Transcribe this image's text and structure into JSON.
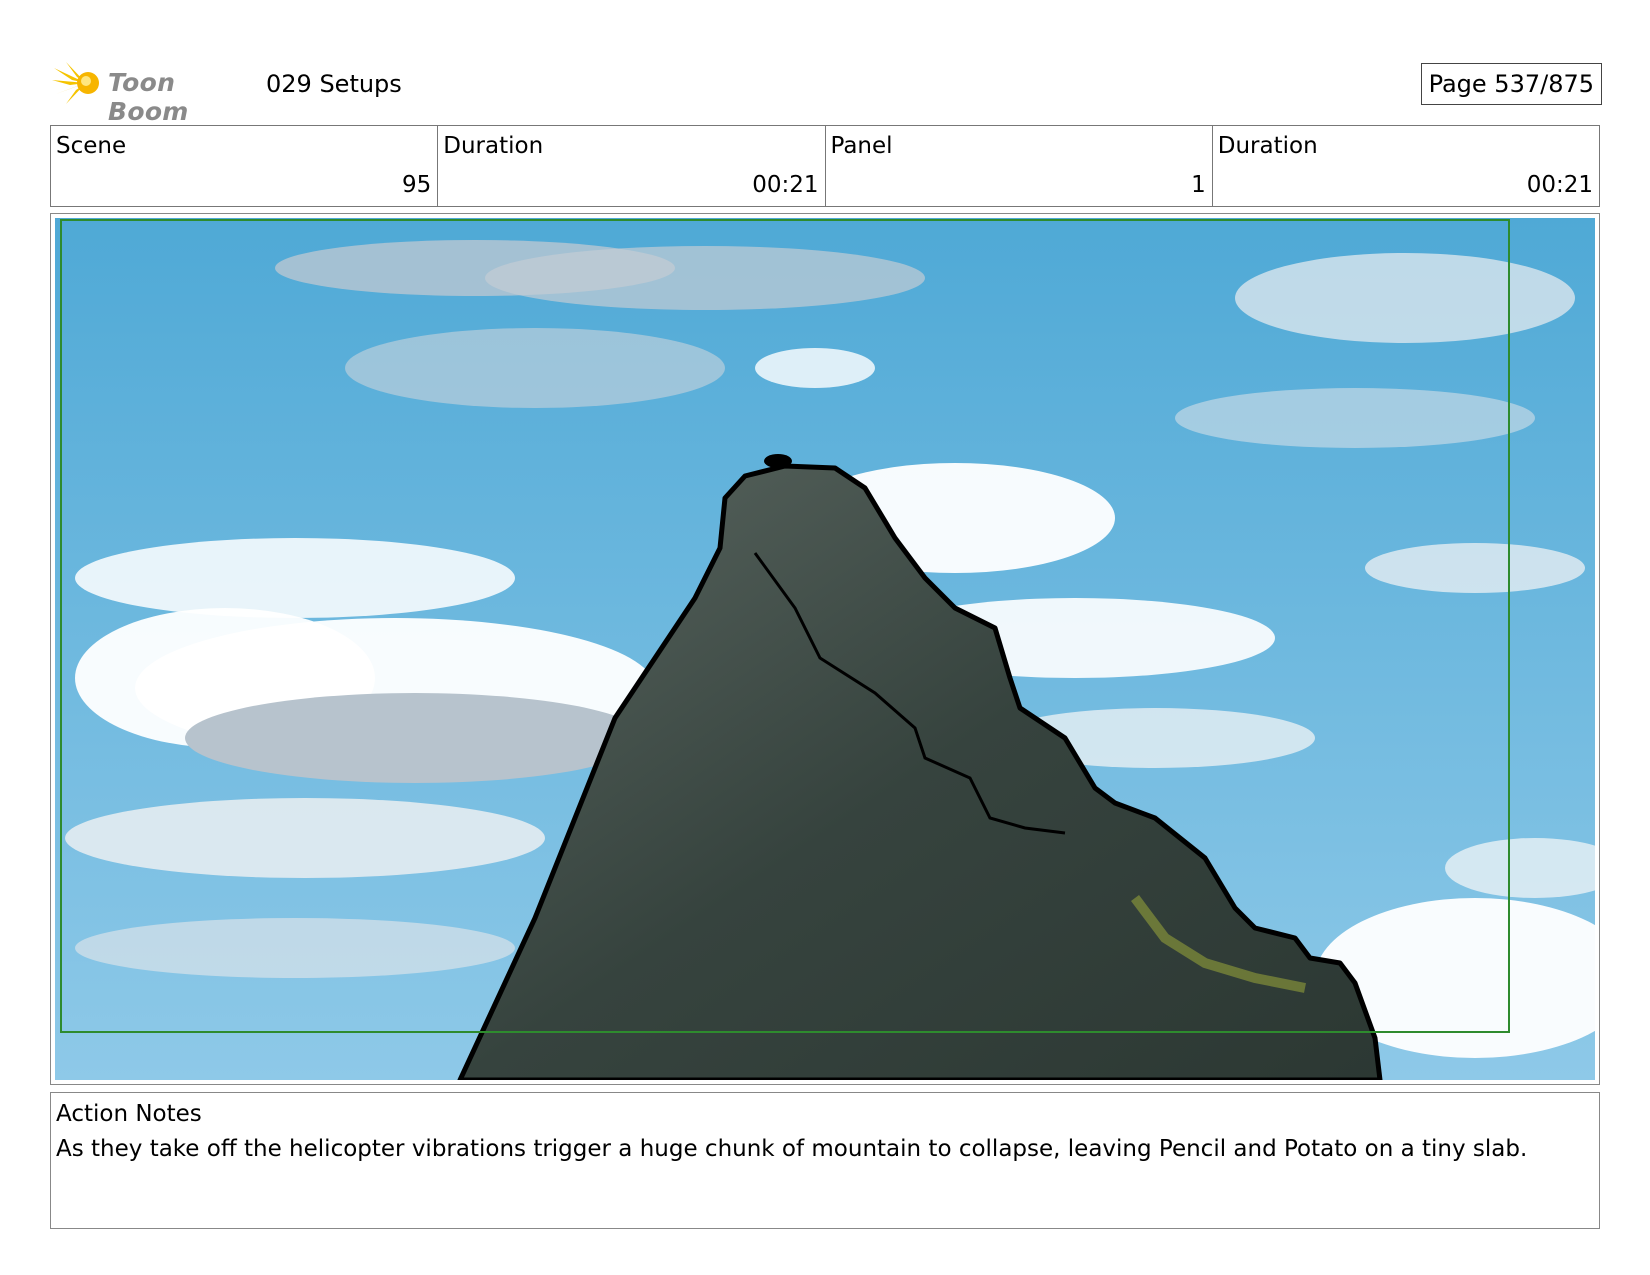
{
  "header": {
    "logo_text": "Toon Boom",
    "project_title": "029 Setups",
    "page_indicator": "Page 537/875"
  },
  "info": {
    "scene_label": "Scene",
    "scene_value": "95",
    "scene_duration_label": "Duration",
    "scene_duration_value": "00:21",
    "panel_label": "Panel",
    "panel_value": "1",
    "panel_duration_label": "Duration",
    "panel_duration_value": "00:21"
  },
  "notes": {
    "label": "Action Notes",
    "text": "As they take off the helicopter vibrations trigger a huge chunk of mountain to collapse, leaving Pencil and Potato on a tiny slab."
  },
  "colors": {
    "sky_top": "#4fa9d6",
    "sky_bottom": "#8ec9e8",
    "mountain": "#3d4a45",
    "frame_green": "#2e8b2e",
    "logo_yellow": "#f5c400"
  }
}
